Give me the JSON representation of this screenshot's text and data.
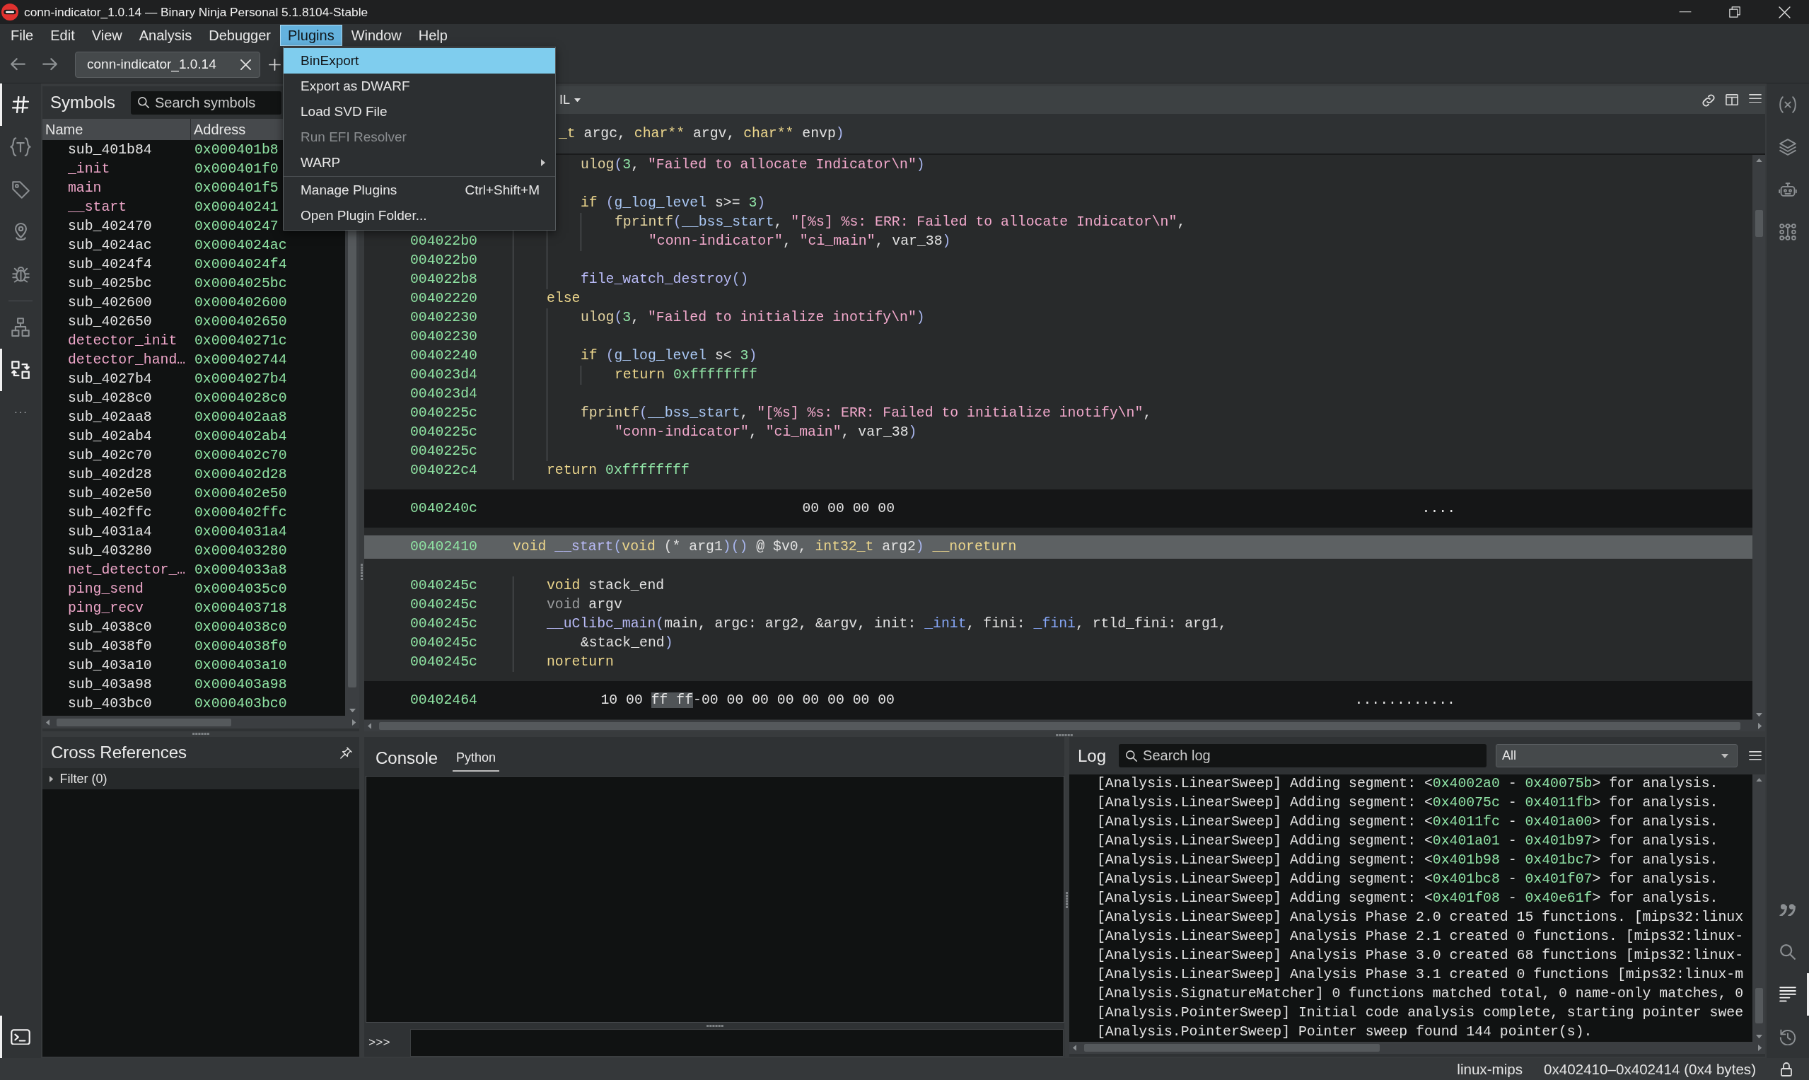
{
  "window": {
    "title": "conn-indicator_1.0.14 — Binary Ninja Personal 5.1.8104-Stable"
  },
  "menu_bar": [
    {
      "label": "File",
      "selected": false
    },
    {
      "label": "Edit",
      "selected": false
    },
    {
      "label": "View",
      "selected": false
    },
    {
      "label": "Analysis",
      "selected": false
    },
    {
      "label": "Debugger",
      "selected": false
    },
    {
      "label": "Plugins",
      "selected": true
    },
    {
      "label": "Window",
      "selected": false
    },
    {
      "label": "Help",
      "selected": false
    }
  ],
  "plugins_menu": [
    {
      "kind": "item",
      "label": "BinExport",
      "selected": true,
      "disabled": false
    },
    {
      "kind": "item",
      "label": "Export as DWARF",
      "selected": false,
      "disabled": false
    },
    {
      "kind": "item",
      "label": "Load SVD File",
      "selected": false,
      "disabled": false
    },
    {
      "kind": "item",
      "label": "Run EFI Resolver",
      "selected": false,
      "disabled": true
    },
    {
      "kind": "submenu",
      "label": "WARP",
      "selected": false,
      "disabled": false
    },
    {
      "kind": "separator"
    },
    {
      "kind": "item",
      "label": "Manage Plugins",
      "shortcut": "Ctrl+Shift+M",
      "selected": false,
      "disabled": false
    },
    {
      "kind": "item",
      "label": "Open Plugin Folder...",
      "selected": false,
      "disabled": false
    }
  ],
  "tabs": [
    {
      "label": "conn-indicator_1.0.14",
      "selected": true
    }
  ],
  "left_sidebar": {
    "top_groups": [
      {
        "items": [
          {
            "selected": true
          },
          {
            "selected": false
          },
          {
            "selected": false
          },
          {
            "selected": false
          },
          {
            "selected": false
          }
        ]
      },
      {
        "items": [
          {
            "selected": false
          },
          {
            "selected": true
          },
          {
            "selected": false
          }
        ]
      }
    ],
    "bottom": [
      {
        "selected": true
      }
    ]
  },
  "symbols": {
    "title": "Symbols",
    "search": {
      "placeholder": "Search symbols"
    },
    "columns": [
      "Name",
      "Address"
    ],
    "rows": [
      {
        "name": "sub_401b84",
        "address": "0x000401b8",
        "kind": "auto"
      },
      {
        "name": "_init",
        "address": "0x000401f0",
        "kind": "named"
      },
      {
        "name": "main",
        "address": "0x000401f5",
        "kind": "named"
      },
      {
        "name": "__start",
        "address": "0x00040241",
        "kind": "named"
      },
      {
        "name": "sub_402470",
        "address": "0x00040247",
        "kind": "auto"
      },
      {
        "name": "sub_4024ac",
        "address": "0x0004024ac",
        "kind": "auto"
      },
      {
        "name": "sub_4024f4",
        "address": "0x0004024f4",
        "kind": "auto"
      },
      {
        "name": "sub_4025bc",
        "address": "0x0004025bc",
        "kind": "auto"
      },
      {
        "name": "sub_402600",
        "address": "0x000402600",
        "kind": "auto"
      },
      {
        "name": "sub_402650",
        "address": "0x000402650",
        "kind": "auto"
      },
      {
        "name": "detector_init",
        "address": "0x00040271c",
        "kind": "named"
      },
      {
        "name": "detector_hand…",
        "address": "0x000402744",
        "kind": "named"
      },
      {
        "name": "sub_4027b4",
        "address": "0x0004027b4",
        "kind": "auto"
      },
      {
        "name": "sub_4028c0",
        "address": "0x0004028c0",
        "kind": "auto"
      },
      {
        "name": "sub_402aa8",
        "address": "0x000402aa8",
        "kind": "auto"
      },
      {
        "name": "sub_402ab4",
        "address": "0x000402ab4",
        "kind": "auto"
      },
      {
        "name": "sub_402c70",
        "address": "0x000402c70",
        "kind": "auto"
      },
      {
        "name": "sub_402d28",
        "address": "0x000402d28",
        "kind": "auto"
      },
      {
        "name": "sub_402e50",
        "address": "0x000402e50",
        "kind": "auto"
      },
      {
        "name": "sub_402ffc",
        "address": "0x000402ffc",
        "kind": "auto"
      },
      {
        "name": "sub_4031a4",
        "address": "0x0004031a4",
        "kind": "auto"
      },
      {
        "name": "sub_403280",
        "address": "0x000403280",
        "kind": "auto"
      },
      {
        "name": "net_detector_…",
        "address": "0x0004033a8",
        "kind": "named"
      },
      {
        "name": "ping_send",
        "address": "0x0004035c0",
        "kind": "named"
      },
      {
        "name": "ping_recv",
        "address": "0x000403718",
        "kind": "named"
      },
      {
        "name": "sub_4038c0",
        "address": "0x0004038c0",
        "kind": "auto"
      },
      {
        "name": "sub_4038f0",
        "address": "0x0004038f0",
        "kind": "auto"
      },
      {
        "name": "sub_403a10",
        "address": "0x000403a10",
        "kind": "auto"
      },
      {
        "name": "sub_403a98",
        "address": "0x000403a98",
        "kind": "auto"
      },
      {
        "name": "sub_403bc0",
        "address": "0x000403bc0",
        "kind": "auto"
      }
    ]
  },
  "code_view": {
    "view_mode": "IL",
    "sticky_header": {
      "tokens": [
        {
          "kind": "keyword",
          "text": "_t"
        },
        {
          "kind": "plain",
          "text": " argc, "
        },
        {
          "kind": "keyword",
          "text": "char**"
        },
        {
          "kind": "plain",
          "text": " argv, "
        },
        {
          "kind": "keyword",
          "text": "char**"
        },
        {
          "kind": "plain",
          "text": " envp"
        },
        {
          "kind": "paren",
          "text": ")"
        }
      ]
    },
    "sections": [
      {
        "kind": "code",
        "body": [
          {
            "children": [
              {
                "lines": [
                  {
                    "kind": "code",
                    "tokens": [
                      {
                        "kind": "import",
                        "text": "ulog"
                      },
                      {
                        "kind": "paren",
                        "text": "("
                      },
                      {
                        "kind": "number",
                        "text": "3"
                      },
                      {
                        "kind": "plain",
                        "text": ", "
                      },
                      {
                        "kind": "string",
                        "text": "\"Failed to allocate Indicator\\n\""
                      },
                      {
                        "kind": "paren",
                        "text": ")"
                      }
                    ]
                  }
                ]
              },
              {
                "lines": [
                  {
                    "kind": "blank"
                  }
                ]
              },
              {
                "lines": [
                  {
                    "kind": "code",
                    "tokens": [
                      {
                        "kind": "keyword",
                        "text": "if "
                      },
                      {
                        "kind": "paren",
                        "text": "("
                      },
                      {
                        "kind": "data",
                        "text": "g_log_level"
                      },
                      {
                        "kind": "plain",
                        "text": " s>= "
                      },
                      {
                        "kind": "number",
                        "text": "3"
                      },
                      {
                        "kind": "paren",
                        "text": ")"
                      }
                    ]
                  }
                ],
                "children": [
                  {
                    "lines": [
                      {
                        "kind": "code",
                        "tokens": [
                          {
                            "kind": "import",
                            "text": "fprintf"
                          },
                          {
                            "kind": "paren",
                            "text": "("
                          },
                          {
                            "kind": "data",
                            "text": "__bss_start"
                          },
                          {
                            "kind": "plain",
                            "text": ", "
                          },
                          {
                            "kind": "string",
                            "text": "\"[%s] %s: ERR: Failed to allocate Indicator\\n\""
                          },
                          {
                            "kind": "plain",
                            "text": ","
                          }
                        ]
                      },
                      {
                        "kind": "code",
                        "address": "004022b0",
                        "tokens": [
                          {
                            "kind": "string",
                            "text": "\"conn-indicator\""
                          },
                          {
                            "kind": "plain",
                            "text": ", "
                          },
                          {
                            "kind": "string",
                            "text": "\"ci_main\""
                          },
                          {
                            "kind": "plain",
                            "text": ", var_38"
                          },
                          {
                            "kind": "paren",
                            "text": ")"
                          }
                        ]
                      }
                    ]
                  }
                ]
              },
              {
                "lines": [
                  {
                    "kind": "blank",
                    "address": "004022b0"
                  }
                ]
              },
              {
                "lines": [
                  {
                    "kind": "code",
                    "address": "004022b8",
                    "tokens": [
                      {
                        "kind": "function",
                        "text": "file_watch_destroy"
                      },
                      {
                        "kind": "paren",
                        "text": "()"
                      }
                    ]
                  }
                ]
              }
            ]
          },
          {
            "lines": [
              {
                "kind": "code",
                "address": "00402220",
                "tokens": [
                  {
                    "kind": "keyword",
                    "text": "else"
                  }
                ]
              }
            ],
            "children": [
              {
                "lines": [
                  {
                    "kind": "code",
                    "address": "00402230",
                    "tokens": [
                      {
                        "kind": "import",
                        "text": "ulog"
                      },
                      {
                        "kind": "paren",
                        "text": "("
                      },
                      {
                        "kind": "number",
                        "text": "3"
                      },
                      {
                        "kind": "plain",
                        "text": ", "
                      },
                      {
                        "kind": "string",
                        "text": "\"Failed to initialize inotify\\n\""
                      },
                      {
                        "kind": "paren",
                        "text": ")"
                      }
                    ]
                  }
                ]
              },
              {
                "lines": [
                  {
                    "kind": "blank",
                    "address": "00402230"
                  }
                ]
              },
              {
                "lines": [
                  {
                    "kind": "code",
                    "address": "00402240",
                    "tokens": [
                      {
                        "kind": "keyword",
                        "text": "if "
                      },
                      {
                        "kind": "paren",
                        "text": "("
                      },
                      {
                        "kind": "data",
                        "text": "g_log_level"
                      },
                      {
                        "kind": "plain",
                        "text": " s< "
                      },
                      {
                        "kind": "number",
                        "text": "3"
                      },
                      {
                        "kind": "paren",
                        "text": ")"
                      }
                    ]
                  }
                ],
                "children": [
                  {
                    "lines": [
                      {
                        "kind": "code",
                        "address": "004023d4",
                        "tokens": [
                          {
                            "kind": "keyword",
                            "text": "return "
                          },
                          {
                            "kind": "number",
                            "text": "0xffffffff"
                          }
                        ]
                      }
                    ]
                  }
                ]
              },
              {
                "lines": [
                  {
                    "kind": "blank",
                    "address": "004023d4"
                  }
                ]
              },
              {
                "lines": [
                  {
                    "kind": "code",
                    "address": "0040225c",
                    "tokens": [
                      {
                        "kind": "import",
                        "text": "fprintf"
                      },
                      {
                        "kind": "paren",
                        "text": "("
                      },
                      {
                        "kind": "data",
                        "text": "__bss_start"
                      },
                      {
                        "kind": "plain",
                        "text": ", "
                      },
                      {
                        "kind": "string",
                        "text": "\"[%s] %s: ERR: Failed to initialize inotify\\n\""
                      },
                      {
                        "kind": "plain",
                        "text": ","
                      }
                    ]
                  },
                  {
                    "kind": "code",
                    "address": "0040225c",
                    "tokens": [
                      {
                        "kind": "string",
                        "text": "\"conn-indicator\""
                      },
                      {
                        "kind": "plain",
                        "text": ", "
                      },
                      {
                        "kind": "string",
                        "text": "\"ci_main\""
                      },
                      {
                        "kind": "plain",
                        "text": ", var_38"
                      },
                      {
                        "kind": "paren",
                        "text": ")"
                      }
                    ]
                  }
                ]
              },
              {
                "lines": [
                  {
                    "kind": "blank",
                    "address": "0040225c"
                  }
                ]
              }
            ]
          },
          {
            "lines": [
              {
                "kind": "code",
                "address": "004022c4",
                "tokens": [
                  {
                    "kind": "keyword",
                    "text": "return "
                  },
                  {
                    "kind": "number",
                    "text": "0xffffffff"
                  }
                ]
              }
            ]
          }
        ]
      },
      {
        "kind": "hex",
        "address": "0040240c",
        "bytes": [
          {
            "text": "00 00 00 00",
            "highlighted": false
          }
        ],
        "ascii": "...."
      },
      {
        "kind": "function",
        "address": "00402410",
        "selected": true,
        "tokens": [
          {
            "kind": "keyword",
            "text": "void "
          },
          {
            "kind": "function",
            "text": "__start"
          },
          {
            "kind": "paren",
            "text": "("
          },
          {
            "kind": "keyword",
            "text": "void"
          },
          {
            "kind": "plain",
            "text": " (* arg1"
          },
          {
            "kind": "paren",
            "text": ")()"
          },
          {
            "kind": "plain",
            "text": " @ $v0, "
          },
          {
            "kind": "keyword",
            "text": "int32_t"
          },
          {
            "kind": "plain",
            "text": " arg2"
          },
          {
            "kind": "paren",
            "text": ")"
          },
          {
            "kind": "keyword",
            "text": " __noreturn"
          }
        ]
      },
      {
        "kind": "code",
        "body": [
          {
            "lines": [
              {
                "kind": "code",
                "address": "0040245c",
                "tokens": [
                  {
                    "kind": "keyword",
                    "text": "void"
                  },
                  {
                    "kind": "plain",
                    "text": " stack_end"
                  }
                ]
              }
            ]
          },
          {
            "lines": [
              {
                "kind": "code",
                "address": "0040245c",
                "tokens": [
                  {
                    "kind": "muted",
                    "text": "void"
                  },
                  {
                    "kind": "plain",
                    "text": " argv"
                  }
                ]
              }
            ]
          },
          {
            "lines": [
              {
                "kind": "code",
                "address": "0040245c",
                "tokens": [
                  {
                    "kind": "function",
                    "text": "__uClibc_main"
                  },
                  {
                    "kind": "paren",
                    "text": "("
                  },
                  {
                    "kind": "plain",
                    "text": "main, argc: arg2, &argv, init: "
                  },
                  {
                    "kind": "symbol",
                    "text": "_init"
                  },
                  {
                    "kind": "plain",
                    "text": ", fini: "
                  },
                  {
                    "kind": "symbol",
                    "text": "_fini"
                  },
                  {
                    "kind": "plain",
                    "text": ", rtld_fini: arg1,"
                  }
                ]
              },
              {
                "kind": "code",
                "address": "0040245c",
                "tokens": [
                  {
                    "kind": "plain",
                    "text": "&stack_end"
                  },
                  {
                    "kind": "paren",
                    "text": ")"
                  }
                ]
              }
            ]
          },
          {
            "lines": [
              {
                "kind": "code",
                "address": "0040245c",
                "tokens": [
                  {
                    "kind": "keyword",
                    "text": "noreturn"
                  }
                ]
              }
            ]
          }
        ]
      },
      {
        "kind": "hex",
        "address": "00402464",
        "bytes": [
          {
            "text": "10 00 ",
            "highlighted": false
          },
          {
            "text": "ff ff",
            "highlighted": true
          },
          {
            "text": "-00 00 00 00 00 00 00 00",
            "highlighted": false
          }
        ],
        "ascii": "............"
      }
    ]
  },
  "cross_references": {
    "title": "Cross References",
    "filter": "Filter (0)",
    "expanded": false
  },
  "console": {
    "title": "Console",
    "tabs": [
      {
        "label": "Python",
        "selected": true
      }
    ],
    "prompt": ">>>"
  },
  "log": {
    "title": "Log",
    "search": {
      "placeholder": "Search log"
    },
    "filter": "All",
    "lines": [
      {
        "tokens": [
          {
            "kind": "plain",
            "text": "[Analysis.LinearSweep] Adding segment: <"
          },
          {
            "kind": "number",
            "text": "0x4002a0"
          },
          {
            "kind": "plain",
            "text": " - "
          },
          {
            "kind": "number",
            "text": "0x40075b"
          },
          {
            "kind": "plain",
            "text": "> for analysis."
          }
        ]
      },
      {
        "tokens": [
          {
            "kind": "plain",
            "text": "[Analysis.LinearSweep] Adding segment: <"
          },
          {
            "kind": "number",
            "text": "0x40075c"
          },
          {
            "kind": "plain",
            "text": " - "
          },
          {
            "kind": "number",
            "text": "0x4011fb"
          },
          {
            "kind": "plain",
            "text": "> for analysis."
          }
        ]
      },
      {
        "tokens": [
          {
            "kind": "plain",
            "text": "[Analysis.LinearSweep] Adding segment: <"
          },
          {
            "kind": "number",
            "text": "0x4011fc"
          },
          {
            "kind": "plain",
            "text": " - "
          },
          {
            "kind": "number",
            "text": "0x401a00"
          },
          {
            "kind": "plain",
            "text": "> for analysis."
          }
        ]
      },
      {
        "tokens": [
          {
            "kind": "plain",
            "text": "[Analysis.LinearSweep] Adding segment: <"
          },
          {
            "kind": "number",
            "text": "0x401a01"
          },
          {
            "kind": "plain",
            "text": " - "
          },
          {
            "kind": "number",
            "text": "0x401b97"
          },
          {
            "kind": "plain",
            "text": "> for analysis."
          }
        ]
      },
      {
        "tokens": [
          {
            "kind": "plain",
            "text": "[Analysis.LinearSweep] Adding segment: <"
          },
          {
            "kind": "number",
            "text": "0x401b98"
          },
          {
            "kind": "plain",
            "text": " - "
          },
          {
            "kind": "number",
            "text": "0x401bc7"
          },
          {
            "kind": "plain",
            "text": "> for analysis."
          }
        ]
      },
      {
        "tokens": [
          {
            "kind": "plain",
            "text": "[Analysis.LinearSweep] Adding segment: <"
          },
          {
            "kind": "number",
            "text": "0x401bc8"
          },
          {
            "kind": "plain",
            "text": " - "
          },
          {
            "kind": "number",
            "text": "0x401f07"
          },
          {
            "kind": "plain",
            "text": "> for analysis."
          }
        ]
      },
      {
        "tokens": [
          {
            "kind": "plain",
            "text": "[Analysis.LinearSweep] Adding segment: <"
          },
          {
            "kind": "number",
            "text": "0x401f08"
          },
          {
            "kind": "plain",
            "text": " - "
          },
          {
            "kind": "number",
            "text": "0x40e61f"
          },
          {
            "kind": "plain",
            "text": "> for analysis."
          }
        ]
      },
      {
        "tokens": [
          {
            "kind": "plain",
            "text": "[Analysis.LinearSweep] Analysis Phase 2.0 created 15 functions. [mips32:linux"
          }
        ]
      },
      {
        "tokens": [
          {
            "kind": "plain",
            "text": "[Analysis.LinearSweep] Analysis Phase 2.1 created 0 functions. [mips32:linux-"
          }
        ]
      },
      {
        "tokens": [
          {
            "kind": "plain",
            "text": "[Analysis.LinearSweep] Analysis Phase 3.0 created 68 functions [mips32:linux-"
          }
        ]
      },
      {
        "tokens": [
          {
            "kind": "plain",
            "text": "[Analysis.LinearSweep] Analysis Phase 3.1 created 0 functions [mips32:linux-m"
          }
        ]
      },
      {
        "tokens": [
          {
            "kind": "plain",
            "text": "[Analysis.SignatureMatcher] 0 functions matched total, 0 name-only matches, 0"
          }
        ]
      },
      {
        "tokens": [
          {
            "kind": "plain",
            "text": "[Analysis.PointerSweep] Initial code analysis complete, starting pointer swee"
          }
        ]
      },
      {
        "tokens": [
          {
            "kind": "plain",
            "text": "[Analysis.PointerSweep] Pointer sweep found 144 pointer(s)."
          }
        ]
      }
    ]
  },
  "right_sidebar": {
    "top": [
      {
        "selected": false
      },
      {
        "selected": false
      },
      {
        "selected": false
      },
      {
        "selected": false
      }
    ],
    "bottom": [
      {
        "selected": false
      },
      {
        "selected": false
      },
      {
        "selected": true
      },
      {
        "selected": false
      }
    ]
  },
  "status_bar": {
    "platform": "linux-mips",
    "selection": "0x402410–0x402414 (0x4 bytes)"
  }
}
